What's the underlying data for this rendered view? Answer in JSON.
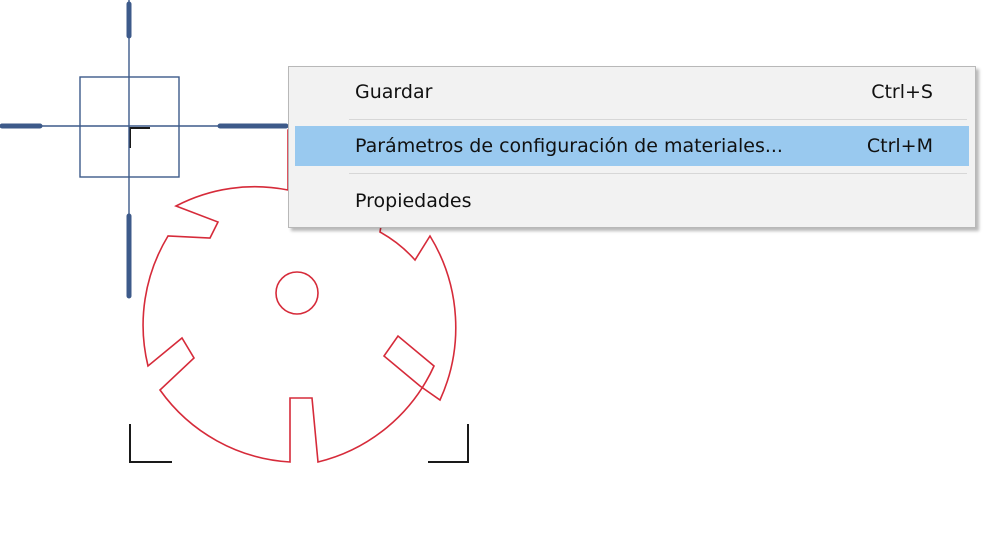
{
  "context_menu": {
    "items": [
      {
        "label": "Guardar",
        "shortcut": "Ctrl+S",
        "highlighted": false
      },
      {
        "label": "Parámetros de configuración de materiales...",
        "shortcut": "Ctrl+M",
        "highlighted": true
      },
      {
        "label": "Propiedades",
        "shortcut": "",
        "highlighted": false
      }
    ]
  },
  "colors": {
    "part_outline": "#d62b3a",
    "crosshair": "#3d5a8a",
    "selection_corners": "#1a1a1a",
    "menu_highlight": "#99c9ef",
    "menu_background": "#f2f2f2"
  }
}
